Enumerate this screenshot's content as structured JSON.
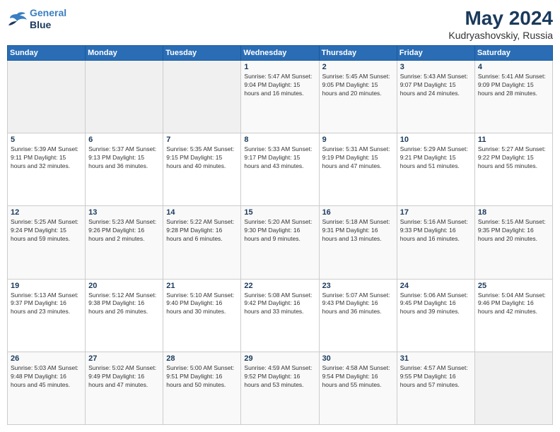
{
  "header": {
    "logo_line1": "General",
    "logo_line2": "Blue",
    "month_year": "May 2024",
    "location": "Kudryashovskiy, Russia"
  },
  "days_of_week": [
    "Sunday",
    "Monday",
    "Tuesday",
    "Wednesday",
    "Thursday",
    "Friday",
    "Saturday"
  ],
  "weeks": [
    [
      {
        "day": "",
        "info": ""
      },
      {
        "day": "",
        "info": ""
      },
      {
        "day": "",
        "info": ""
      },
      {
        "day": "1",
        "info": "Sunrise: 5:47 AM\nSunset: 9:04 PM\nDaylight: 15 hours\nand 16 minutes."
      },
      {
        "day": "2",
        "info": "Sunrise: 5:45 AM\nSunset: 9:05 PM\nDaylight: 15 hours\nand 20 minutes."
      },
      {
        "day": "3",
        "info": "Sunrise: 5:43 AM\nSunset: 9:07 PM\nDaylight: 15 hours\nand 24 minutes."
      },
      {
        "day": "4",
        "info": "Sunrise: 5:41 AM\nSunset: 9:09 PM\nDaylight: 15 hours\nand 28 minutes."
      }
    ],
    [
      {
        "day": "5",
        "info": "Sunrise: 5:39 AM\nSunset: 9:11 PM\nDaylight: 15 hours\nand 32 minutes."
      },
      {
        "day": "6",
        "info": "Sunrise: 5:37 AM\nSunset: 9:13 PM\nDaylight: 15 hours\nand 36 minutes."
      },
      {
        "day": "7",
        "info": "Sunrise: 5:35 AM\nSunset: 9:15 PM\nDaylight: 15 hours\nand 40 minutes."
      },
      {
        "day": "8",
        "info": "Sunrise: 5:33 AM\nSunset: 9:17 PM\nDaylight: 15 hours\nand 43 minutes."
      },
      {
        "day": "9",
        "info": "Sunrise: 5:31 AM\nSunset: 9:19 PM\nDaylight: 15 hours\nand 47 minutes."
      },
      {
        "day": "10",
        "info": "Sunrise: 5:29 AM\nSunset: 9:21 PM\nDaylight: 15 hours\nand 51 minutes."
      },
      {
        "day": "11",
        "info": "Sunrise: 5:27 AM\nSunset: 9:22 PM\nDaylight: 15 hours\nand 55 minutes."
      }
    ],
    [
      {
        "day": "12",
        "info": "Sunrise: 5:25 AM\nSunset: 9:24 PM\nDaylight: 15 hours\nand 59 minutes."
      },
      {
        "day": "13",
        "info": "Sunrise: 5:23 AM\nSunset: 9:26 PM\nDaylight: 16 hours\nand 2 minutes."
      },
      {
        "day": "14",
        "info": "Sunrise: 5:22 AM\nSunset: 9:28 PM\nDaylight: 16 hours\nand 6 minutes."
      },
      {
        "day": "15",
        "info": "Sunrise: 5:20 AM\nSunset: 9:30 PM\nDaylight: 16 hours\nand 9 minutes."
      },
      {
        "day": "16",
        "info": "Sunrise: 5:18 AM\nSunset: 9:31 PM\nDaylight: 16 hours\nand 13 minutes."
      },
      {
        "day": "17",
        "info": "Sunrise: 5:16 AM\nSunset: 9:33 PM\nDaylight: 16 hours\nand 16 minutes."
      },
      {
        "day": "18",
        "info": "Sunrise: 5:15 AM\nSunset: 9:35 PM\nDaylight: 16 hours\nand 20 minutes."
      }
    ],
    [
      {
        "day": "19",
        "info": "Sunrise: 5:13 AM\nSunset: 9:37 PM\nDaylight: 16 hours\nand 23 minutes."
      },
      {
        "day": "20",
        "info": "Sunrise: 5:12 AM\nSunset: 9:38 PM\nDaylight: 16 hours\nand 26 minutes."
      },
      {
        "day": "21",
        "info": "Sunrise: 5:10 AM\nSunset: 9:40 PM\nDaylight: 16 hours\nand 30 minutes."
      },
      {
        "day": "22",
        "info": "Sunrise: 5:08 AM\nSunset: 9:42 PM\nDaylight: 16 hours\nand 33 minutes."
      },
      {
        "day": "23",
        "info": "Sunrise: 5:07 AM\nSunset: 9:43 PM\nDaylight: 16 hours\nand 36 minutes."
      },
      {
        "day": "24",
        "info": "Sunrise: 5:06 AM\nSunset: 9:45 PM\nDaylight: 16 hours\nand 39 minutes."
      },
      {
        "day": "25",
        "info": "Sunrise: 5:04 AM\nSunset: 9:46 PM\nDaylight: 16 hours\nand 42 minutes."
      }
    ],
    [
      {
        "day": "26",
        "info": "Sunrise: 5:03 AM\nSunset: 9:48 PM\nDaylight: 16 hours\nand 45 minutes."
      },
      {
        "day": "27",
        "info": "Sunrise: 5:02 AM\nSunset: 9:49 PM\nDaylight: 16 hours\nand 47 minutes."
      },
      {
        "day": "28",
        "info": "Sunrise: 5:00 AM\nSunset: 9:51 PM\nDaylight: 16 hours\nand 50 minutes."
      },
      {
        "day": "29",
        "info": "Sunrise: 4:59 AM\nSunset: 9:52 PM\nDaylight: 16 hours\nand 53 minutes."
      },
      {
        "day": "30",
        "info": "Sunrise: 4:58 AM\nSunset: 9:54 PM\nDaylight: 16 hours\nand 55 minutes."
      },
      {
        "day": "31",
        "info": "Sunrise: 4:57 AM\nSunset: 9:55 PM\nDaylight: 16 hours\nand 57 minutes."
      },
      {
        "day": "",
        "info": ""
      }
    ]
  ]
}
